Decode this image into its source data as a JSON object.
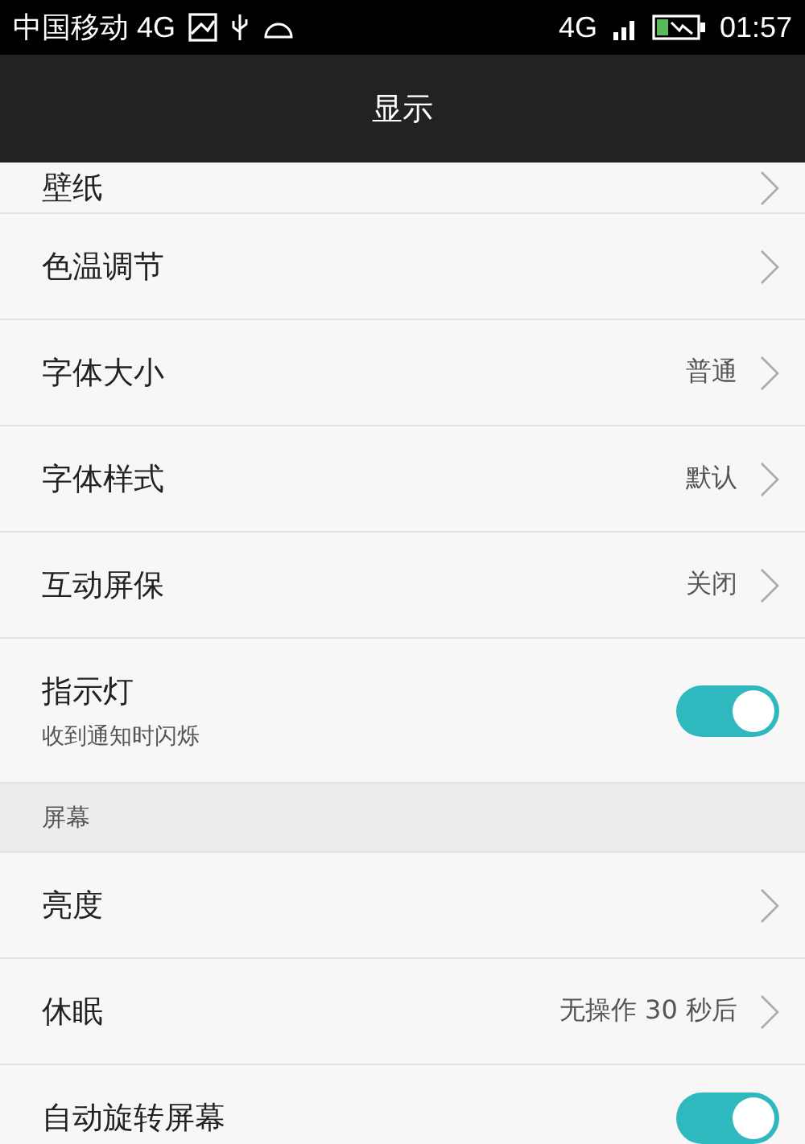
{
  "status_bar": {
    "carrier": "中国移动 4G",
    "network": "4G",
    "time": "01:57"
  },
  "header": {
    "title": "显示"
  },
  "items": [
    {
      "kind": "nav",
      "label": "壁纸"
    },
    {
      "kind": "nav",
      "label": "色温调节"
    },
    {
      "kind": "nav",
      "label": "字体大小",
      "value": "普通"
    },
    {
      "kind": "nav",
      "label": "字体样式",
      "value": "默认"
    },
    {
      "kind": "nav",
      "label": "互动屏保",
      "value": "关闭"
    },
    {
      "kind": "toggle",
      "label": "指示灯",
      "subtitle": "收到通知时闪烁",
      "on": true
    },
    {
      "kind": "section",
      "label": "屏幕"
    },
    {
      "kind": "nav",
      "label": "亮度"
    },
    {
      "kind": "nav",
      "label": "休眠",
      "value": "无操作 30 秒后"
    },
    {
      "kind": "toggle",
      "label": "自动旋转屏幕",
      "on": true
    }
  ]
}
